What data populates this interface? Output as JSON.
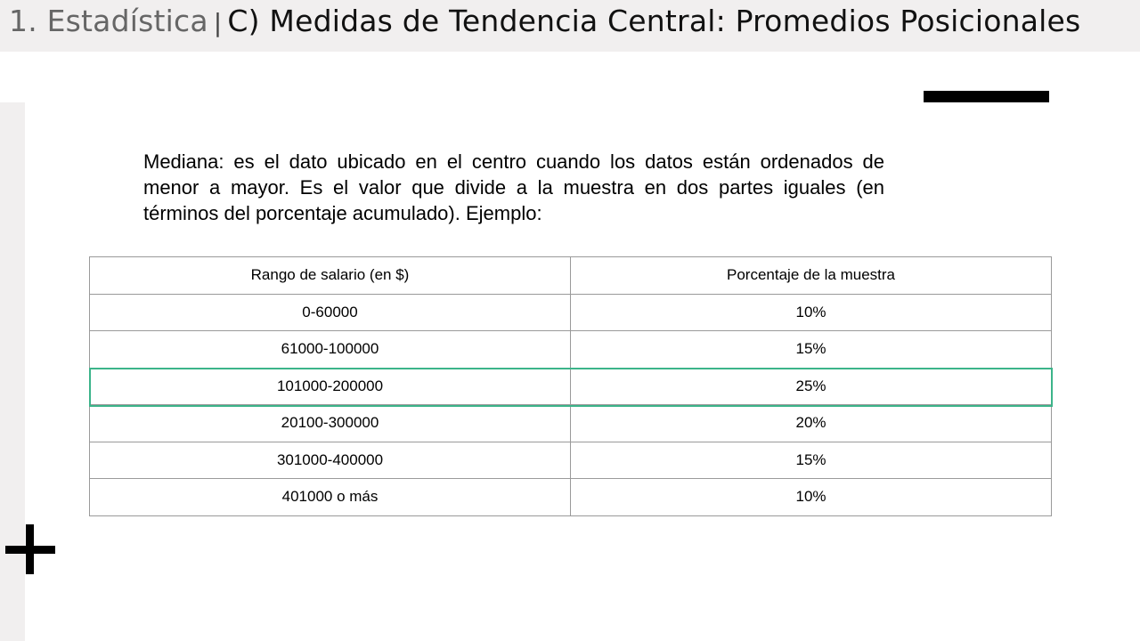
{
  "slide": {
    "title_prefix": "1. Estadística",
    "title_separator": "|",
    "title_main": "C) Medidas de Tendencia Central: Promedios Posicionales",
    "paragraph": "Mediana: es el dato ubicado en el centro cuando los datos están ordenados de menor a mayor. Es el valor que divide a la muestra en dos partes iguales (en términos del porcentaje acumulado). Ejemplo:"
  },
  "table": {
    "headers": [
      "Rango de salario (en $)",
      "Porcentaje de la muestra"
    ],
    "rows": [
      [
        "0-60000",
        "10%"
      ],
      [
        "61000-100000",
        "15%"
      ],
      [
        "101000-200000",
        "25%"
      ],
      [
        "20100-300000",
        "20%"
      ],
      [
        "301000-400000",
        "15%"
      ],
      [
        "401000 o más",
        "10%"
      ]
    ],
    "highlight_color": "#3cb48a"
  },
  "colors": {
    "header_bg": "#f1efef",
    "accent": "#3cb48a"
  }
}
